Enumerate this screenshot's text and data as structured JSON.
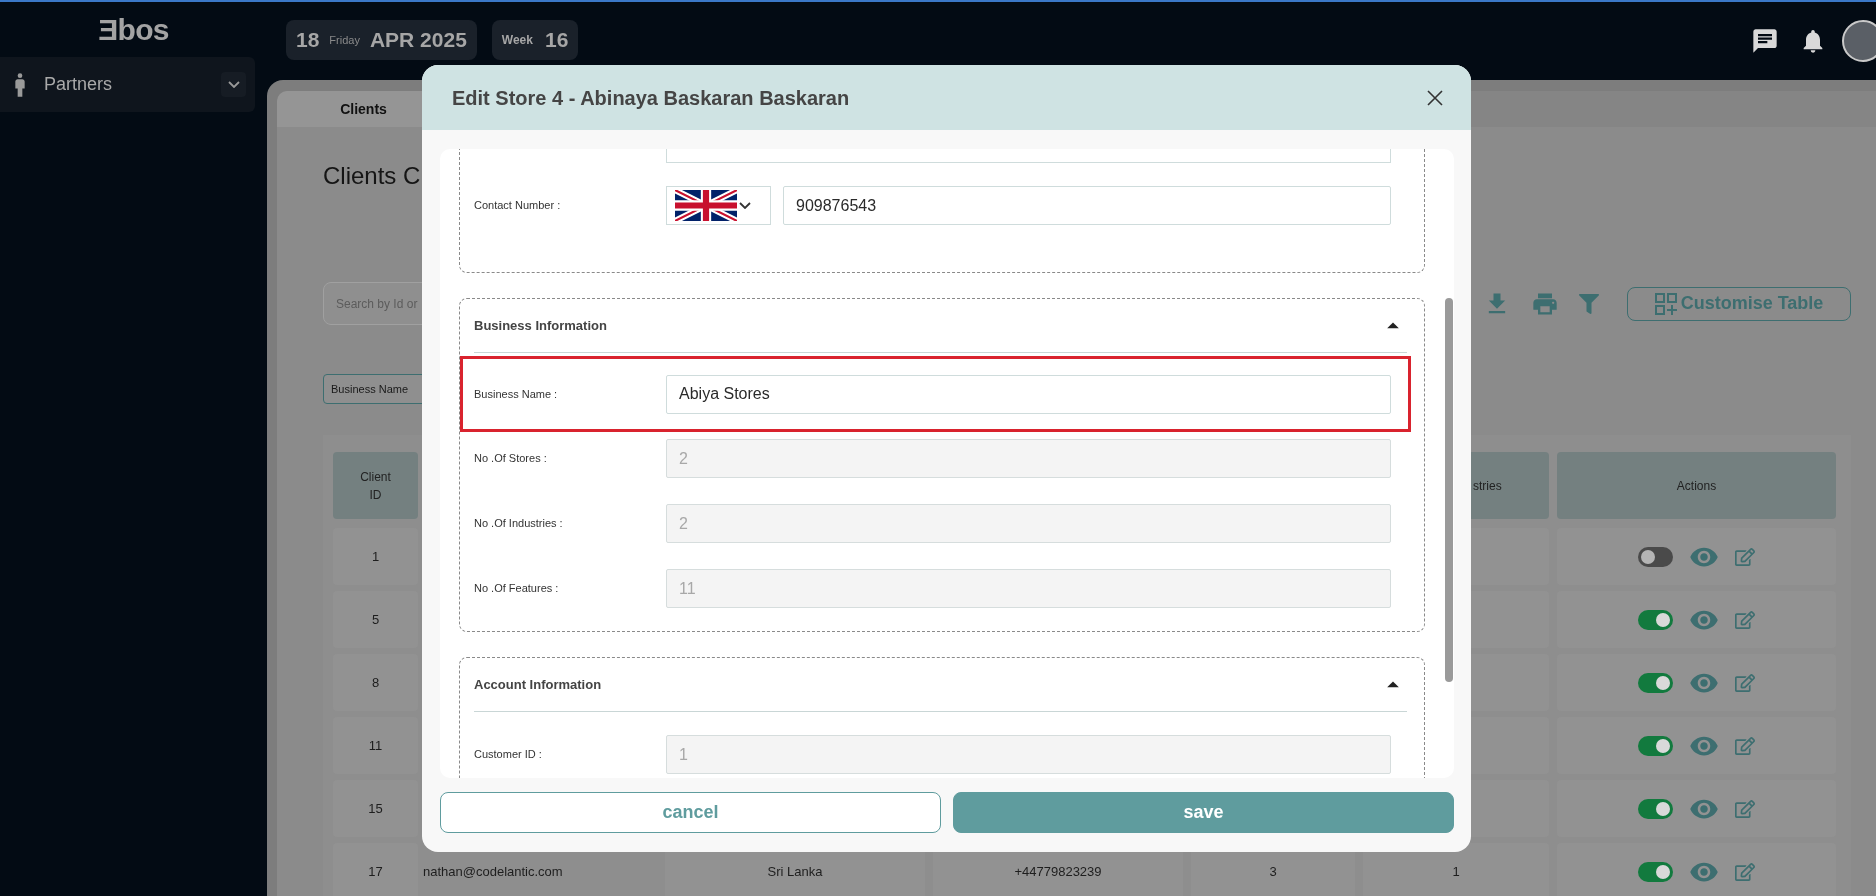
{
  "top_bar": {
    "logo": "Ǝbos",
    "date": {
      "day": "18",
      "weekday": "Friday",
      "month_year": "APR 2025"
    },
    "week": {
      "label": "Week",
      "number": "16"
    }
  },
  "sidebar": {
    "items": [
      {
        "label": "Partners",
        "expanded": false
      }
    ]
  },
  "page": {
    "tabs": [
      {
        "label": "Clients",
        "selected": true
      }
    ],
    "title": "Clients C",
    "search": {
      "placeholder": "Search by Id or"
    },
    "filter_chip": "Business Name",
    "customise_button": "Customise Table"
  },
  "table": {
    "columns": [
      {
        "label": "Client ID"
      },
      {
        "label": "stries"
      },
      {
        "label": "Actions"
      }
    ],
    "rows": [
      {
        "client_id": "1",
        "active": false
      },
      {
        "client_id": "5",
        "active": true
      },
      {
        "client_id": "8",
        "active": true
      },
      {
        "client_id": "11",
        "active": true
      },
      {
        "client_id": "15",
        "active": true
      },
      {
        "client_id": "17",
        "email": "nathan@codelantic.com",
        "country": "Sri Lanka",
        "phone": "+44779823239",
        "column_5": "3",
        "column_6": "1",
        "active": true
      }
    ]
  },
  "modal": {
    "title": "Edit Store 4 - Abinaya Baskaran Baskaran",
    "sections": [
      {
        "top_cut": true,
        "fields": [
          {
            "label": "Contact Number :",
            "kind": "phone",
            "value": "909876543",
            "disabled": false,
            "highlighted": false
          }
        ]
      },
      {
        "title": "Business Information",
        "expanded": true,
        "fields": [
          {
            "label": "Business Name :",
            "kind": "text",
            "value": "Abiya Stores",
            "disabled": false,
            "highlighted": true
          },
          {
            "label": "No .Of Stores :",
            "kind": "text",
            "value": "2",
            "disabled": true,
            "highlighted": false
          },
          {
            "label": "No .Of Industries :",
            "kind": "text",
            "value": "2",
            "disabled": true,
            "highlighted": false
          },
          {
            "label": "No .Of Features :",
            "kind": "text",
            "value": "11",
            "disabled": true,
            "highlighted": false
          }
        ]
      },
      {
        "title": "Account Information",
        "expanded": true,
        "fields": [
          {
            "label": "Customer ID :",
            "kind": "text",
            "value": "1",
            "disabled": true,
            "highlighted": false
          }
        ]
      }
    ],
    "buttons": [
      {
        "label": "cancel",
        "kind": "secondary"
      },
      {
        "label": "save",
        "kind": "primary"
      }
    ]
  }
}
